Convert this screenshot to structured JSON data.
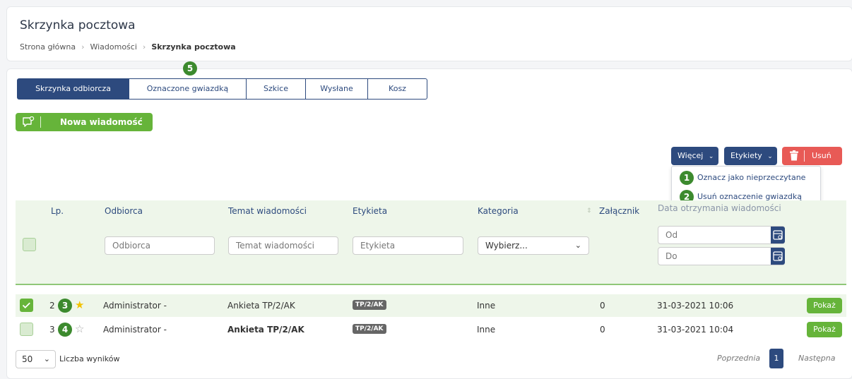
{
  "header": {
    "title": "Skrzynka pocztowa",
    "breadcrumb": [
      "Strona główna",
      "Wiadomości",
      "Skrzynka pocztowa"
    ]
  },
  "tabs": [
    "Skrzynka odbiorcza",
    "Oznaczone gwiazdką",
    "Szkice",
    "Wysłane",
    "Kosz"
  ],
  "active_tab": "Skrzynka odbiorcza",
  "toolbar": {
    "new_message": "Nowa wiadomość",
    "more": "Więcej",
    "labels": "Etykiety",
    "delete": "Usuń"
  },
  "more_menu": {
    "items": [
      "Oznacz jako nieprzeczytane",
      "Usuń oznaczenie gwiazdką"
    ]
  },
  "annotations": [
    "1",
    "2",
    "3",
    "4",
    "5"
  ],
  "table": {
    "headers": [
      "Lp.",
      "Odbiorca",
      "Temat wiadomości",
      "Etykieta",
      "Kategoria",
      "Załącznik",
      "Data otrzymania wiadomości"
    ],
    "filters": {
      "recipient_placeholder": "Odbiorca",
      "subject_placeholder": "Temat wiadomości",
      "label_placeholder": "Etykieta",
      "category_value": "Wybierz...",
      "date_from": "Od",
      "date_to": "Do"
    },
    "rows": [
      {
        "lp": "2",
        "recipient": "Administrator -",
        "subject": "Ankieta TP/2/AK",
        "tag": "TP/2/AK",
        "category": "Inne",
        "attachments": "0",
        "date": "31-03-2021 10:06",
        "action": "Pokaż",
        "checked": true,
        "starred": true,
        "unread": false
      },
      {
        "lp": "3",
        "recipient": "Administrator -",
        "subject": "Ankieta TP/2/AK",
        "tag": "TP/2/AK",
        "category": "Inne",
        "attachments": "0",
        "date": "31-03-2021 10:04",
        "action": "Pokaż",
        "checked": false,
        "starred": false,
        "unread": true
      }
    ]
  },
  "pagination": {
    "per_page": "50",
    "per_page_label": "Liczba wyników",
    "prev": "Poprzednia",
    "current": "1",
    "next": "Następna"
  },
  "colors": {
    "primary": "#2d4a7e",
    "green": "#66b43a",
    "badge": "#3c8a2e",
    "danger": "#e85a56",
    "star": "#f2c200"
  }
}
